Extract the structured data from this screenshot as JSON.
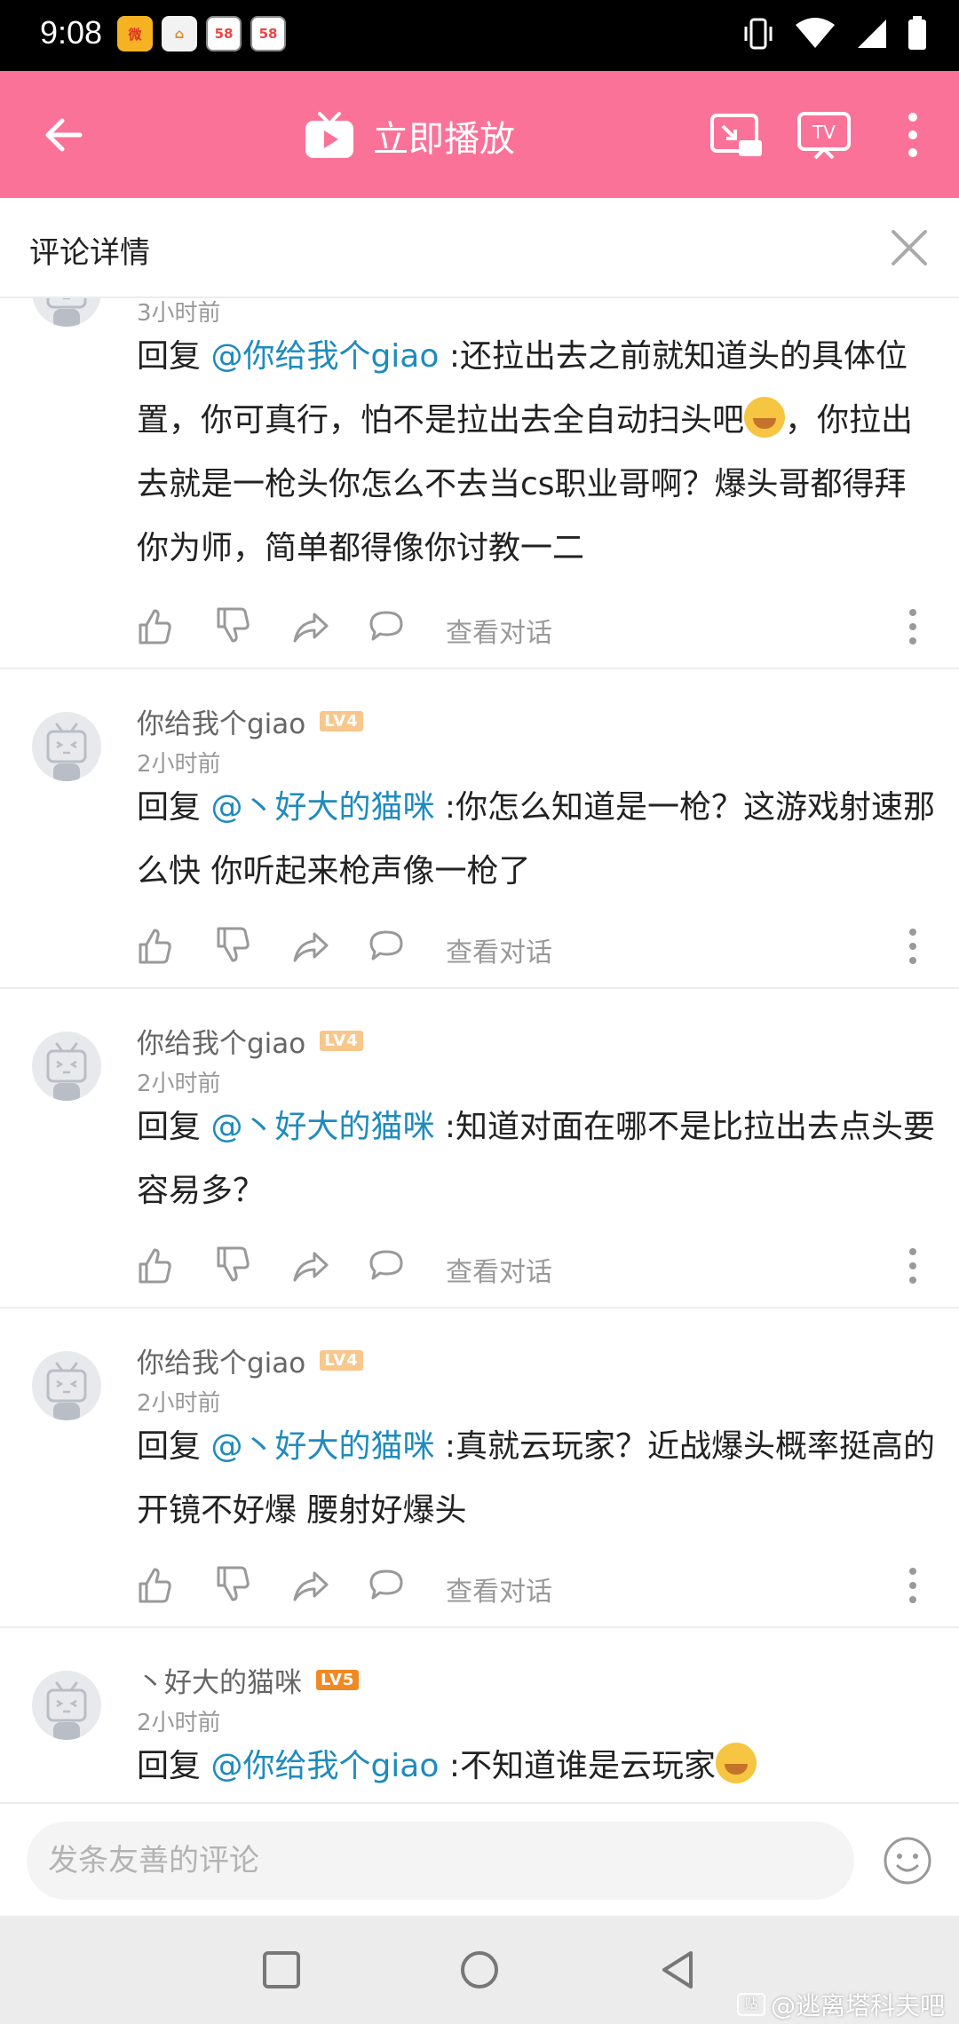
{
  "status_bar": {
    "time": "9:08",
    "notification_icons": [
      "weibo-icon",
      "cleaner-icon",
      "app-58-icon",
      "app-58-icon"
    ],
    "notif_labels": [
      "微",
      "⌂",
      "58",
      "58"
    ]
  },
  "app_bar": {
    "play_label": "立即播放",
    "actions": [
      "back-arrow-icon",
      "play-tv-icon",
      "cast-icon",
      "tv-icon",
      "more-vert-icon"
    ],
    "brand_color": "#fb7299"
  },
  "detail": {
    "title": "评论详情"
  },
  "comments": [
    {
      "username": "",
      "level": "",
      "time": "3小时前",
      "text_prefix": "回复 ",
      "mention": "@你给我个giao",
      "text": " :还拉出去之前就知道头的具体位置，你可真行，怕不是拉出去全自动扫头吧",
      "emoji": "grin-emoji",
      "text_after": "，你拉出去就是一枪头你怎么不去当cs职业哥啊？爆头哥都得拜你为师，简单都得像你讨教一二",
      "view_label": "查看对话"
    },
    {
      "username": "你给我个giao",
      "level": "LV4",
      "time": "2小时前",
      "text_prefix": "回复 ",
      "mention": "@丶好大的猫咪",
      "text": " :你怎么知道是一枪？这游戏射速那么快  你听起来枪声像一枪了",
      "view_label": "查看对话"
    },
    {
      "username": "你给我个giao",
      "level": "LV4",
      "time": "2小时前",
      "text_prefix": "回复 ",
      "mention": "@丶好大的猫咪",
      "text": " :知道对面在哪不是比拉出去点头要容易多？",
      "view_label": "查看对话"
    },
    {
      "username": "你给我个giao",
      "level": "LV4",
      "time": "2小时前",
      "text_prefix": "回复 ",
      "mention": "@丶好大的猫咪",
      "text": " :真就云玩家？近战爆头概率挺高的 开镜不好爆 腰射好爆头",
      "view_label": "查看对话"
    },
    {
      "username": "丶好大的猫咪",
      "level": "LV5",
      "time": "2小时前",
      "text_prefix": "回复 ",
      "mention": "@你给我个giao",
      "text": " :不知道谁是云玩家",
      "emoji": "grin-emoji",
      "view_label": "查看对话"
    }
  ],
  "input": {
    "placeholder": "发条友善的评论"
  },
  "nav": {
    "buttons": [
      "recents-square-icon",
      "home-circle-icon",
      "back-triangle-icon"
    ]
  },
  "watermark": {
    "text": "@逃离塔科夫吧",
    "logo": "贴"
  },
  "colors": {
    "mention": "#1e8bbd",
    "level4": "#f7c78c",
    "level5": "#f08a24"
  }
}
